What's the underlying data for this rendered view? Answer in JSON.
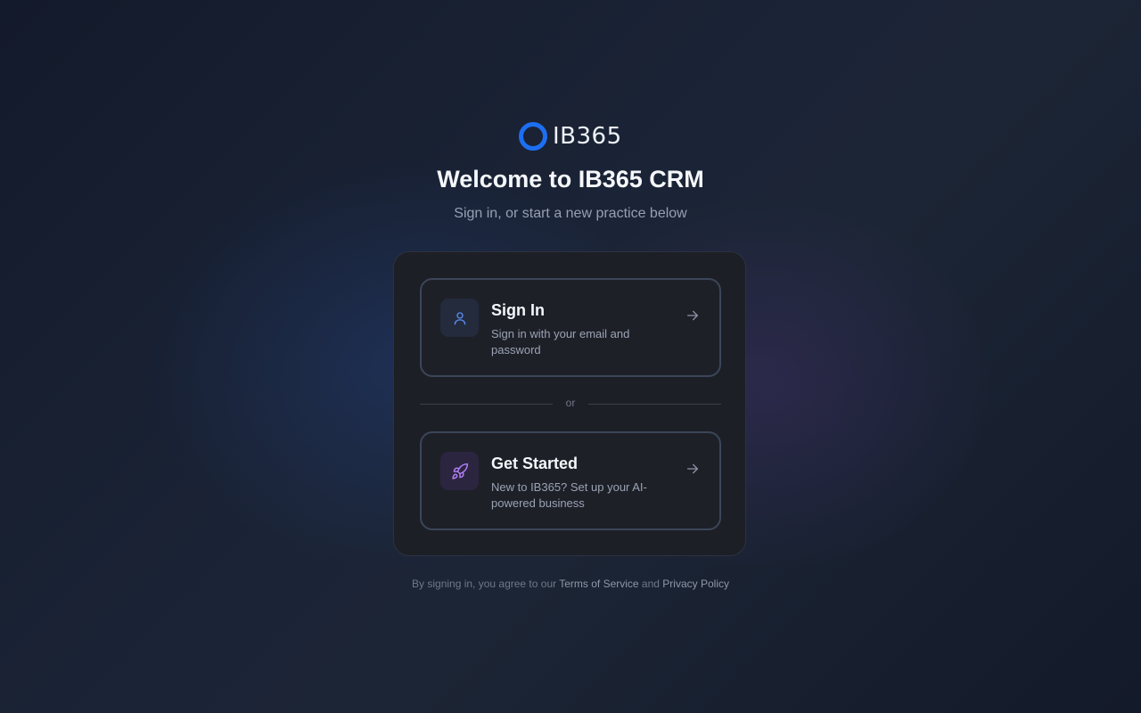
{
  "brand": {
    "name": "IB365",
    "accent_color": "#1d6ff2"
  },
  "header": {
    "title": "Welcome to IB365 CRM",
    "subtitle": "Sign in, or start a new practice below"
  },
  "options": {
    "sign_in": {
      "icon": "user-icon",
      "icon_color": "#5b8def",
      "title": "Sign In",
      "description": "Sign in with your email and password"
    },
    "divider_text": "or",
    "get_started": {
      "icon": "rocket-icon",
      "icon_color": "#b07cf0",
      "title": "Get Started",
      "description": "New to IB365? Set up your AI-powered business"
    }
  },
  "footer": {
    "prefix": "By signing in, you agree to our ",
    "terms_label": "Terms of Service",
    "conjunction": " and ",
    "privacy_label": "Privacy Policy"
  }
}
